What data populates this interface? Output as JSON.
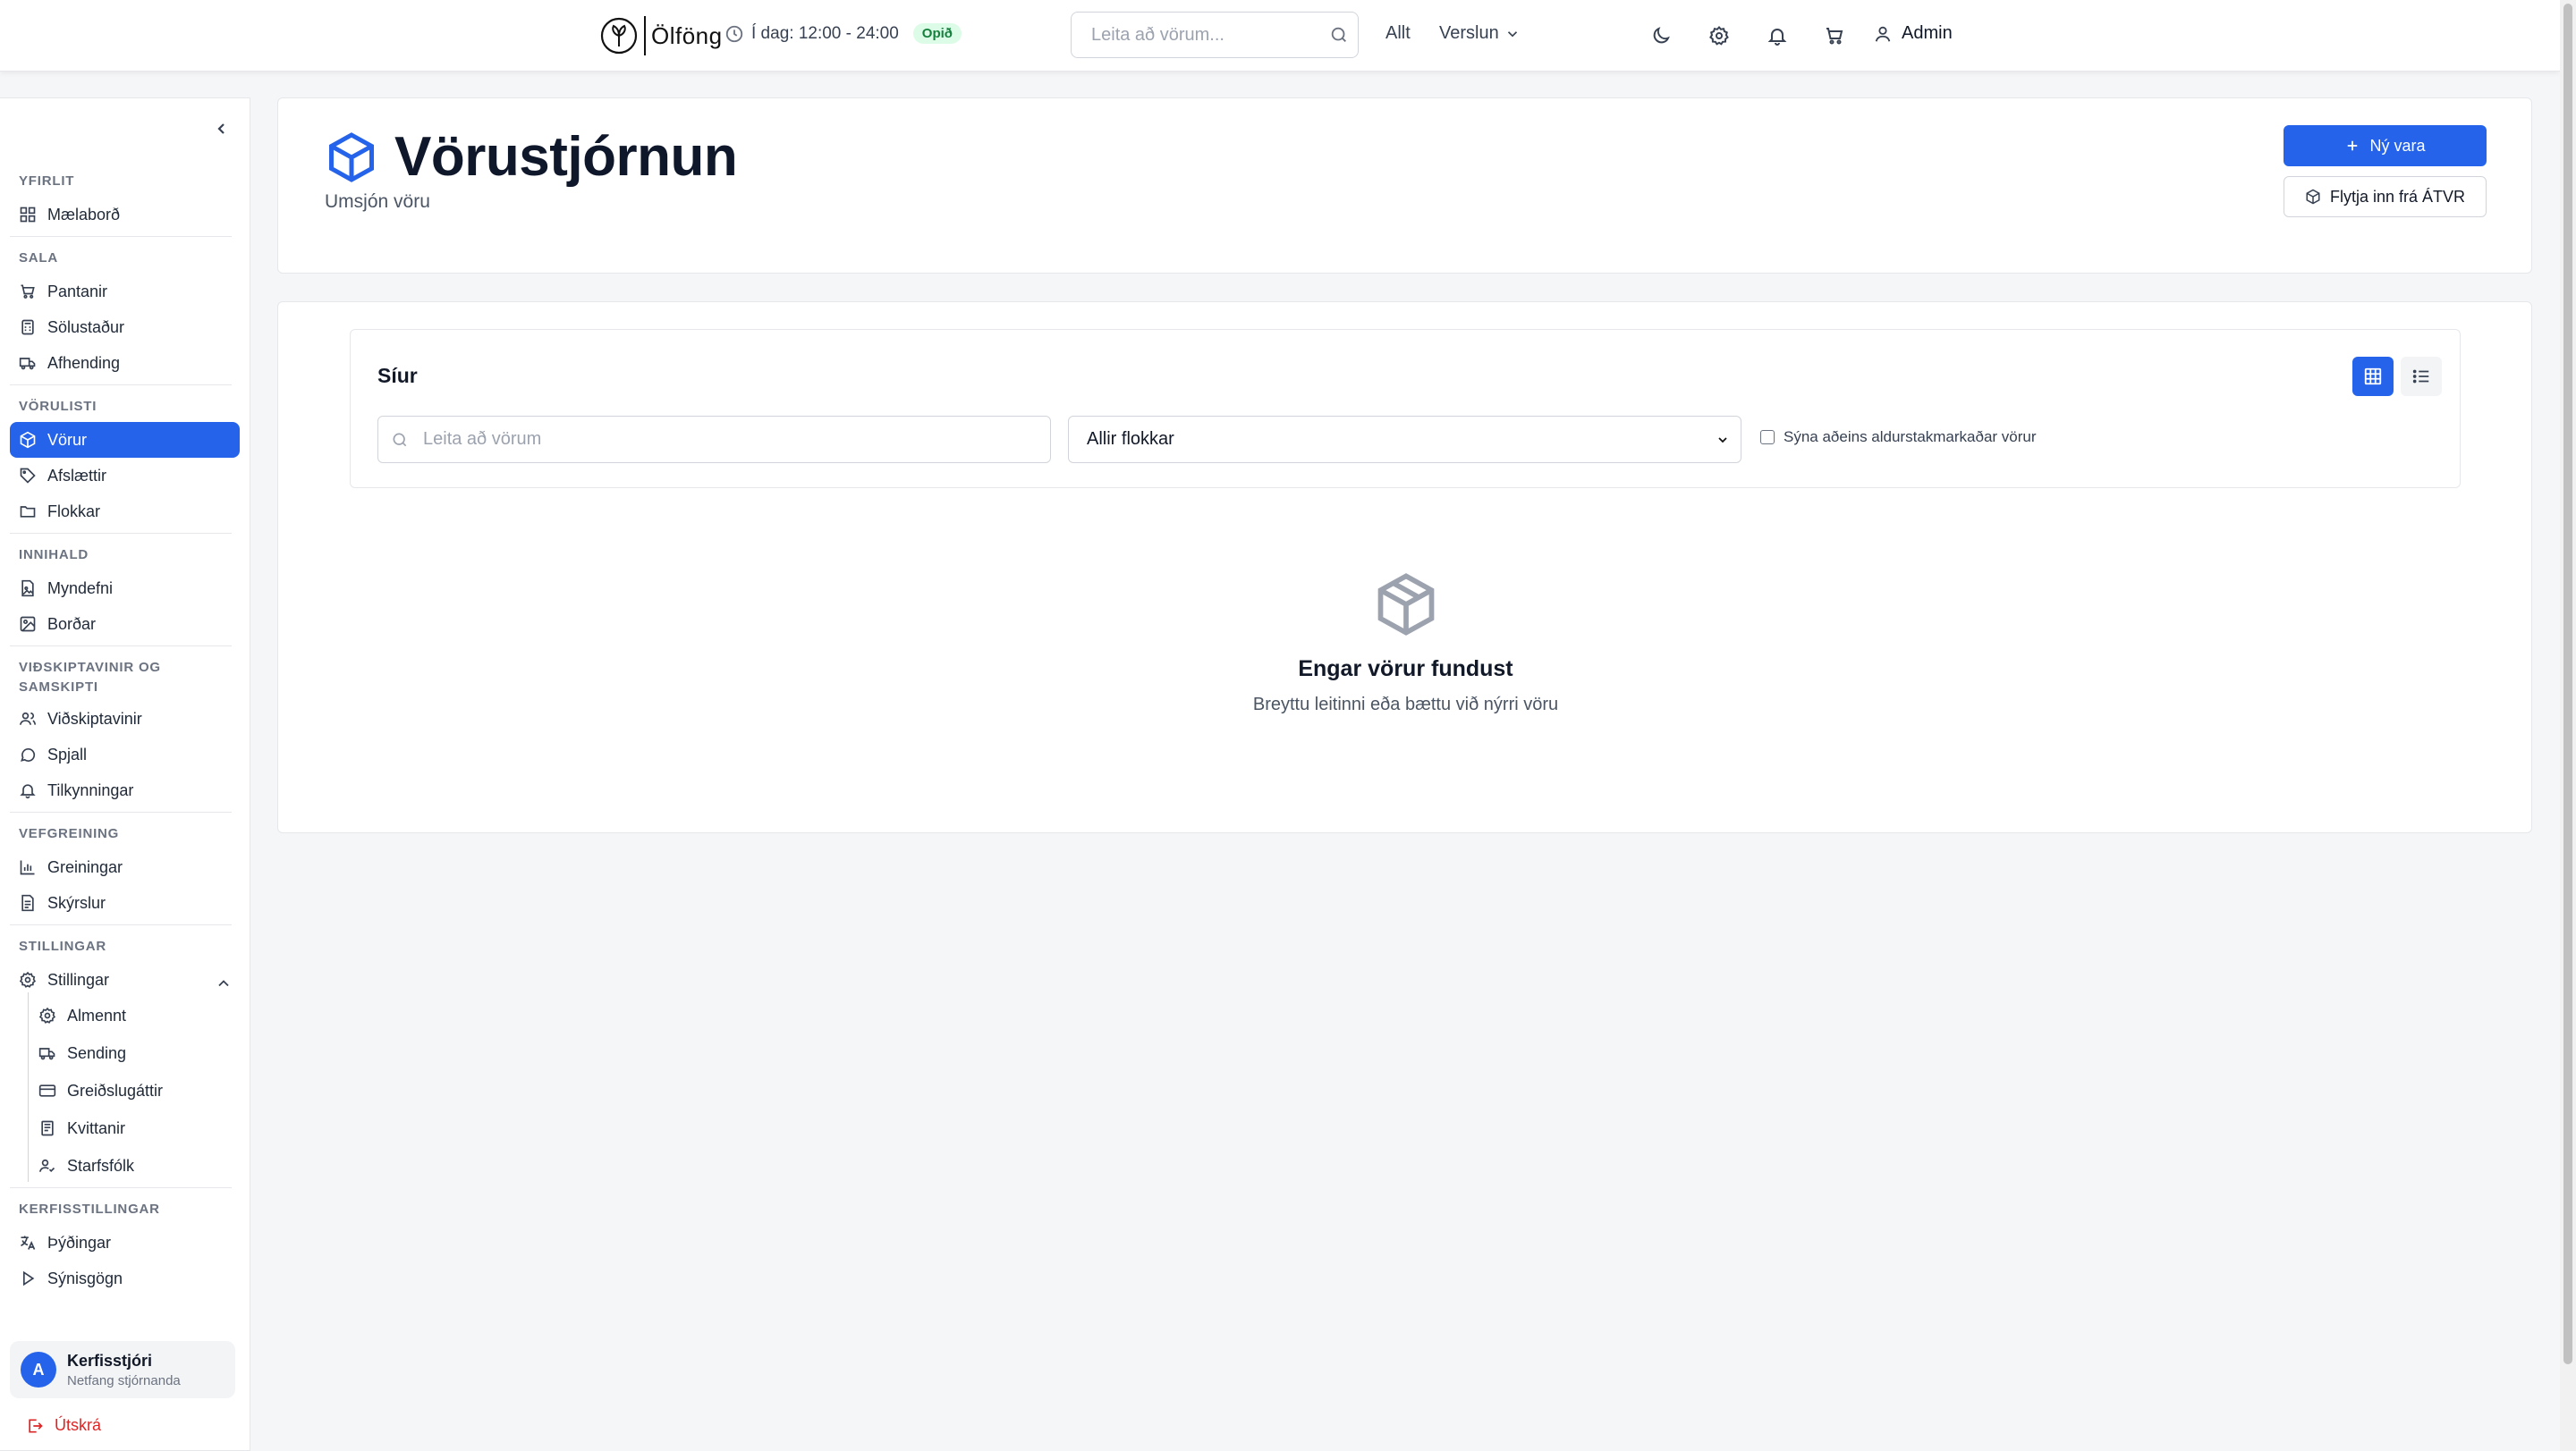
{
  "topbar": {
    "logo_text": "Ölföng",
    "hours": "Í dag: 12:00 - 24:00",
    "open_status": "Opið",
    "search_placeholder": "Leita að vörum...",
    "nav_all": "Allt",
    "nav_shop": "Verslun",
    "user_label": "Admin"
  },
  "sidebar": {
    "sections": {
      "overview": "YFIRLIT",
      "sales": "SALA",
      "catalog": "VÖRULISTI",
      "content": "INNIHALD",
      "customers_line1": "VIÐSKIPTAVINIR OG",
      "customers_line2": "SAMSKIPTI",
      "analytics": "VEFGREINING",
      "settings": "STILLINGAR",
      "system": "KERFISSTILLINGAR"
    },
    "items": {
      "dashboard": "Mælaborð",
      "orders": "Pantanir",
      "pos": "Sölustaður",
      "delivery": "Afhending",
      "products": "Vörur",
      "discounts": "Afslættir",
      "categories": "Flokkar",
      "media": "Myndefni",
      "banners": "Borðar",
      "customers": "Viðskiptavinir",
      "chat": "Spjall",
      "notifications": "Tilkynningar",
      "analytics": "Greiningar",
      "reports": "Skýrslur",
      "settings": "Stillingar",
      "general": "Almennt",
      "shipping": "Sending",
      "payments": "Greiðslugáttir",
      "receipts": "Kvittanir",
      "staff": "Starfsfólk",
      "translations": "Þýðingar",
      "demo_data": "Sýnisgögn"
    },
    "user": {
      "initial": "A",
      "name": "Kerfisstjóri",
      "email": "Netfang stjórnanda"
    },
    "logout": "Útskrá"
  },
  "header": {
    "title": "Vörustjórnun",
    "subtitle": "Umsjón vöru",
    "new_product": "Ný vara",
    "import": "Flytja inn frá ÁTVR"
  },
  "filters": {
    "title": "Síur",
    "search_placeholder": "Leita að vörum",
    "category_selected": "Allir flokkar",
    "age_restricted_label": "Sýna aðeins aldurstakmarkaðar vörur"
  },
  "empty_state": {
    "title": "Engar vörur fundust",
    "subtitle": "Breyttu leitinni eða bættu við nýrri vöru"
  },
  "colors": {
    "accent": "#2563eb",
    "open_badge_bg": "#dcfce7",
    "open_badge_text": "#15803d",
    "logout": "#dc2626"
  }
}
